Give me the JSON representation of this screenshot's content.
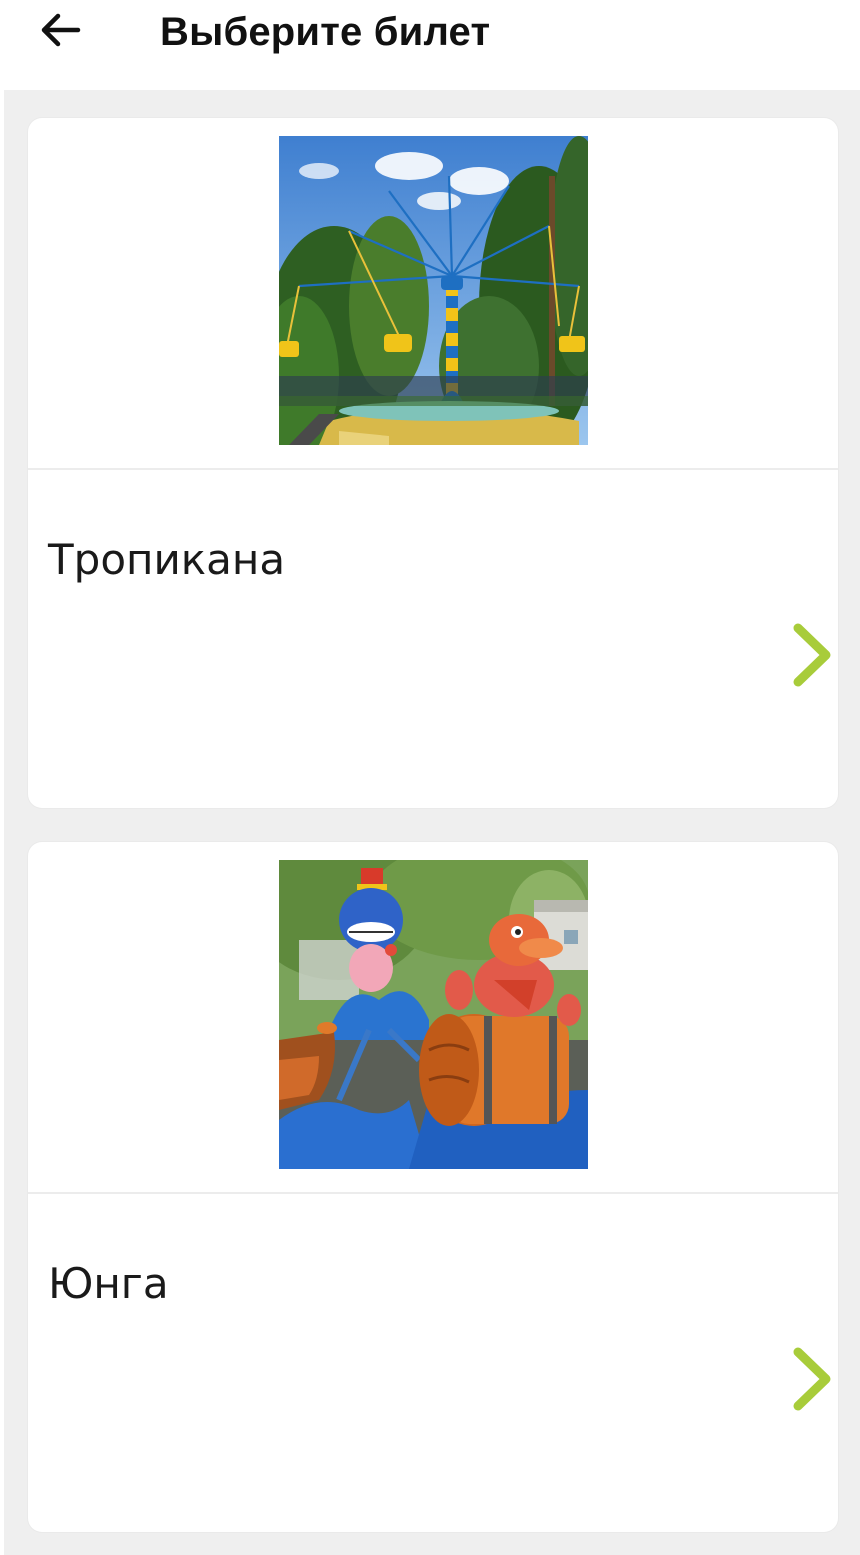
{
  "header": {
    "title": "Выберите билет",
    "back_icon": "arrow-left-icon"
  },
  "tickets": [
    {
      "name": "Тропикана",
      "image_icon": "chain-swing-ride-photo"
    },
    {
      "name": "Юнга",
      "image_icon": "kids-carousel-photo"
    }
  ],
  "colors": {
    "chevron": "#a8cc3a",
    "background": "#efefef",
    "card": "#ffffff"
  },
  "chevron_icon": "chevron-right-icon"
}
